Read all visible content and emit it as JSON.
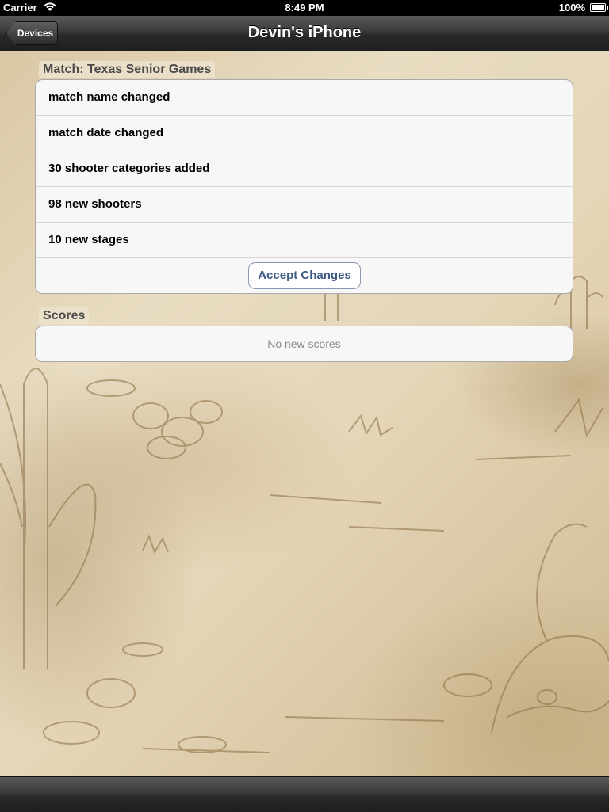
{
  "status": {
    "carrier": "Carrier",
    "time": "8:49 PM",
    "battery": "100%"
  },
  "nav": {
    "back_label": "Devices",
    "title": "Devin's iPhone"
  },
  "match_section": {
    "header": "Match: Texas Senior Games",
    "rows": [
      "match name changed",
      "match date changed",
      "30 shooter categories added",
      "98 new shooters",
      "10 new stages"
    ],
    "accept_label": "Accept Changes"
  },
  "scores_section": {
    "header": "Scores",
    "empty_text": "No new scores"
  },
  "icons": {
    "wifi": "wifi-icon",
    "battery": "battery-icon",
    "back": "chevron-left-icon"
  }
}
